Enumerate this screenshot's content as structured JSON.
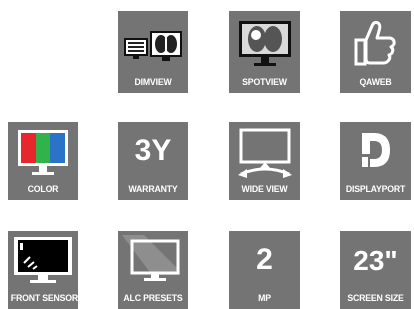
{
  "tiles": {
    "dimview": {
      "label": "DIMVIEW",
      "icon": "dual-monitor-xray-icon"
    },
    "spotview": {
      "label": "SPOTVIEW",
      "icon": "monitor-xray-spot-icon"
    },
    "qaweb": {
      "label": "QAWEB",
      "icon": "thumbs-up-icon"
    },
    "color": {
      "label": "COLOR",
      "icon": "color-monitor-icon",
      "colors": [
        "#e8262b",
        "#2fb34a",
        "#2a73c6"
      ]
    },
    "warranty": {
      "label": "WARRANTY",
      "value": "3Y"
    },
    "wide_view": {
      "label": "WIDE VIEW",
      "icon": "wide-angle-monitor-icon"
    },
    "displayport": {
      "label": "DISPLAYPORT",
      "icon": "displayport-logo-icon"
    },
    "front_sensor": {
      "label": "FRONT SENSOR",
      "icon": "front-sensor-monitor-icon"
    },
    "alc_presets": {
      "label": "ALC PRESETS",
      "icon": "ambient-light-monitor-icon"
    },
    "mp": {
      "label": "MP",
      "value": "2"
    },
    "screen_size": {
      "label": "SCREEN SIZE",
      "value": "23\""
    }
  }
}
